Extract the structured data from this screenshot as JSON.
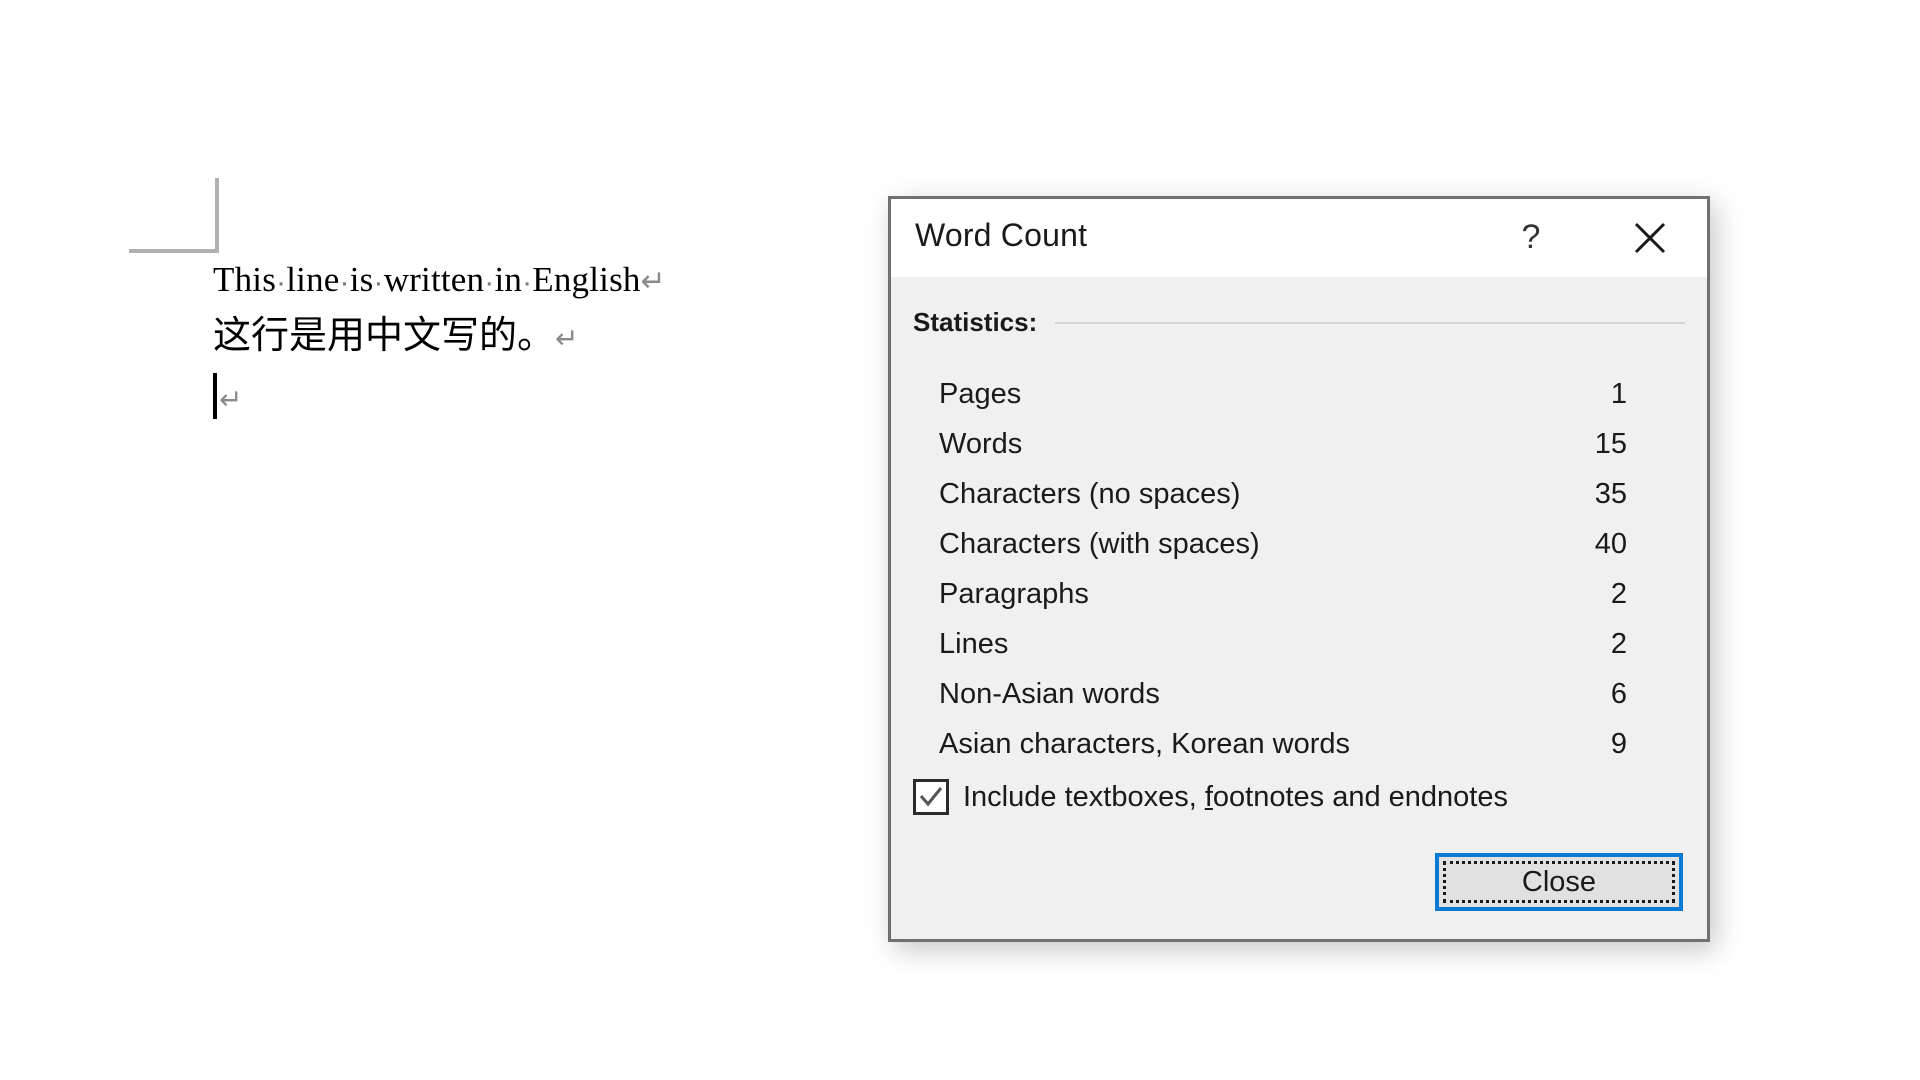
{
  "document": {
    "lines": [
      {
        "id": "line-english",
        "kind": "text-en",
        "words": [
          "This",
          "line",
          "is",
          "written",
          "in",
          "English"
        ],
        "text": "This line is written in English",
        "paragraph_mark": "↵"
      },
      {
        "id": "line-chinese",
        "kind": "text-cn",
        "text": "这行是用中文写的。",
        "paragraph_mark": "↵"
      },
      {
        "id": "line-empty",
        "kind": "empty",
        "text": "",
        "paragraph_mark": "↵"
      }
    ],
    "formatting_marks_visible": true,
    "space_dot_glyph": "·"
  },
  "dialog": {
    "title": "Word Count",
    "help_label": "?",
    "close_x_label": "✕",
    "statistics_label": "Statistics:",
    "stats": [
      {
        "name": "Pages",
        "value": "1"
      },
      {
        "name": "Words",
        "value": "15"
      },
      {
        "name": "Characters (no spaces)",
        "value": "35"
      },
      {
        "name": "Characters (with spaces)",
        "value": "40"
      },
      {
        "name": "Paragraphs",
        "value": "2"
      },
      {
        "name": "Lines",
        "value": "2"
      },
      {
        "name": "Non-Asian words",
        "value": "6"
      },
      {
        "name": "Asian characters, Korean words",
        "value": "9"
      }
    ],
    "checkbox": {
      "checked": true,
      "label_before": "Include textboxes, ",
      "label_accel": "f",
      "label_after": "ootnotes and endnotes",
      "label_full": "Include textboxes, footnotes and endnotes"
    },
    "close_button": {
      "label": "Close",
      "focused": true
    },
    "colors": {
      "dialog_bg": "#f0f0f0",
      "titlebar_bg": "#ffffff",
      "border": "#707070",
      "accent_focus": "#0a7bd4",
      "button_face": "#e1e1e1",
      "text": "#1a1a1a",
      "rule": "#d6d6d6",
      "margin_mark": "#b0b0b0"
    }
  }
}
